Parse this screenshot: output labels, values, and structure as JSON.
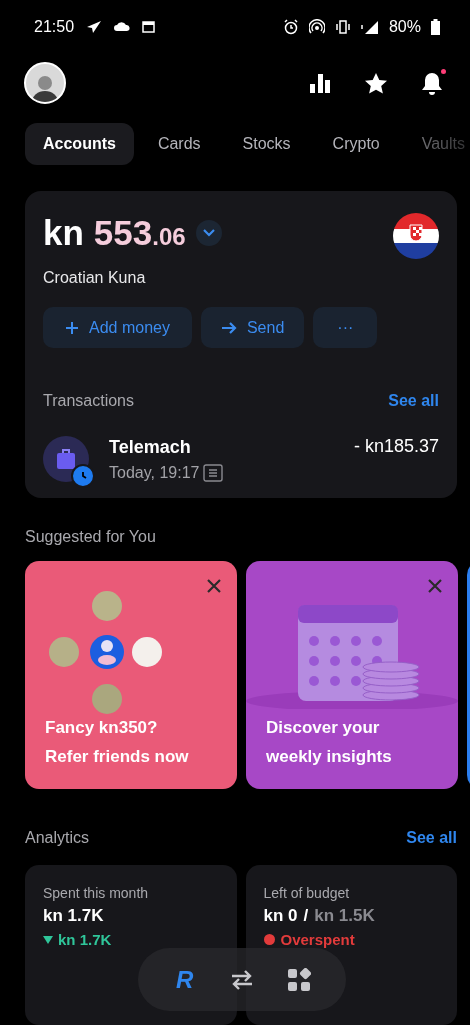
{
  "status_bar": {
    "time": "21:50",
    "battery": "80%"
  },
  "header": {
    "notification_dot": true
  },
  "tabs": [
    {
      "label": "Accounts",
      "selected": true
    },
    {
      "label": "Cards",
      "selected": false
    },
    {
      "label": "Stocks",
      "selected": false
    },
    {
      "label": "Crypto",
      "selected": false
    },
    {
      "label": "Vaults",
      "selected": false
    }
  ],
  "account": {
    "currency": "kn",
    "integer": "553",
    "decimals": ".06",
    "name": "Croatian Kuna",
    "actions": [
      {
        "kind": "add",
        "label": "Add money"
      },
      {
        "kind": "send",
        "label": "Send"
      },
      {
        "kind": "more",
        "label": "···"
      }
    ],
    "transactions_title": "Transactions",
    "see_all": "See all",
    "transactions": [
      {
        "name": "Telemach",
        "time": "Today, 19:17",
        "amount": "- kn185.37",
        "pending": true
      }
    ]
  },
  "suggested": {
    "title": "Suggested for You",
    "cards": [
      {
        "kind": "referral",
        "color": "#ea5a78",
        "title": "Fancy kn350?",
        "subtitle": "Refer friends now"
      },
      {
        "kind": "insights",
        "color": "#a748c6",
        "title": "Discover your",
        "subtitle": "weekly insights"
      },
      {
        "kind": "plain",
        "color": "#2b7ff0"
      }
    ]
  },
  "analytics": {
    "title": "Analytics",
    "see_all": "See all",
    "cards": [
      {
        "kind": "spent",
        "label": "Spent this month",
        "value": "kn 1.7K",
        "change": "kn 1.7K"
      },
      {
        "kind": "budget",
        "label": "Left of budget",
        "value": "kn 0",
        "separator": "/",
        "total": "kn 1.5K",
        "status": "Overspent"
      }
    ]
  },
  "nav": [
    {
      "kind": "logo",
      "label": "R",
      "selected": true
    },
    {
      "kind": "transfer",
      "selected": false
    },
    {
      "kind": "hub",
      "selected": false
    }
  ]
}
